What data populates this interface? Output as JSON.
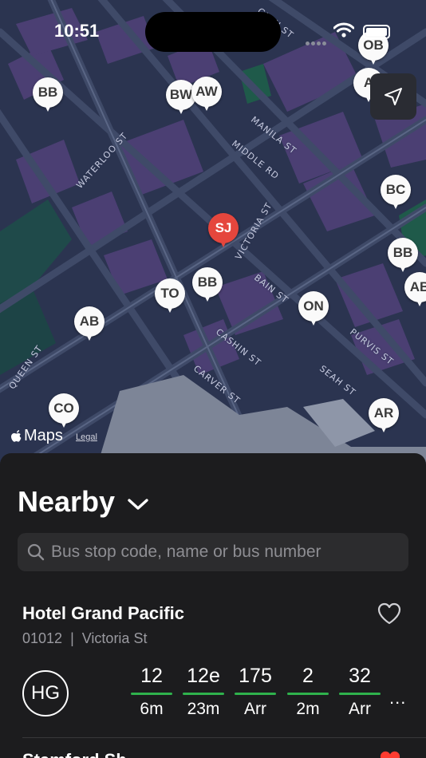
{
  "status_bar": {
    "time": "10:51"
  },
  "map": {
    "streets": [
      "WATERLOO ST",
      "MANILA ST",
      "MIDDLE RD",
      "VICTORIA ST",
      "BAIN ST",
      "CASHIN ST",
      "CARVER ST",
      "PURVIS ST",
      "SEAH ST",
      "QUEEN ST",
      "GLEN ST"
    ],
    "pins": [
      {
        "label": "BB",
        "color": "white"
      },
      {
        "label": "BW",
        "color": "white"
      },
      {
        "label": "AW",
        "color": "white"
      },
      {
        "label": "OB",
        "color": "white"
      },
      {
        "label": "A",
        "color": "white"
      },
      {
        "label": "BC",
        "color": "white"
      },
      {
        "label": "SJ",
        "color": "red"
      },
      {
        "label": "BB",
        "color": "white"
      },
      {
        "label": "AB",
        "color": "white"
      },
      {
        "label": "TO",
        "color": "white"
      },
      {
        "label": "BB",
        "color": "white"
      },
      {
        "label": "ON",
        "color": "white"
      },
      {
        "label": "AB",
        "color": "white"
      },
      {
        "label": "CO",
        "color": "white"
      },
      {
        "label": "AR",
        "color": "white"
      }
    ],
    "logo": "Maps",
    "legal": "Legal"
  },
  "sheet": {
    "title": "Nearby",
    "search_placeholder": "Bus stop code, name or bus number",
    "stop": {
      "name": "Hotel Grand Pacific",
      "code": "01012",
      "road": "Victoria St",
      "avatar": "HG",
      "services": [
        {
          "number": "12",
          "eta": "6m"
        },
        {
          "number": "12e",
          "eta": "23m"
        },
        {
          "number": "175",
          "eta": "Arr"
        },
        {
          "number": "2",
          "eta": "2m"
        },
        {
          "number": "32",
          "eta": "Arr"
        }
      ],
      "more": "..."
    },
    "next_stop_name": "Stamford Sh..."
  },
  "colors": {
    "accent_green": "#2fb24c",
    "pin_red": "#e5463d",
    "sheet_bg": "#1c1c1e",
    "favorite_red": "#ff3b30"
  }
}
